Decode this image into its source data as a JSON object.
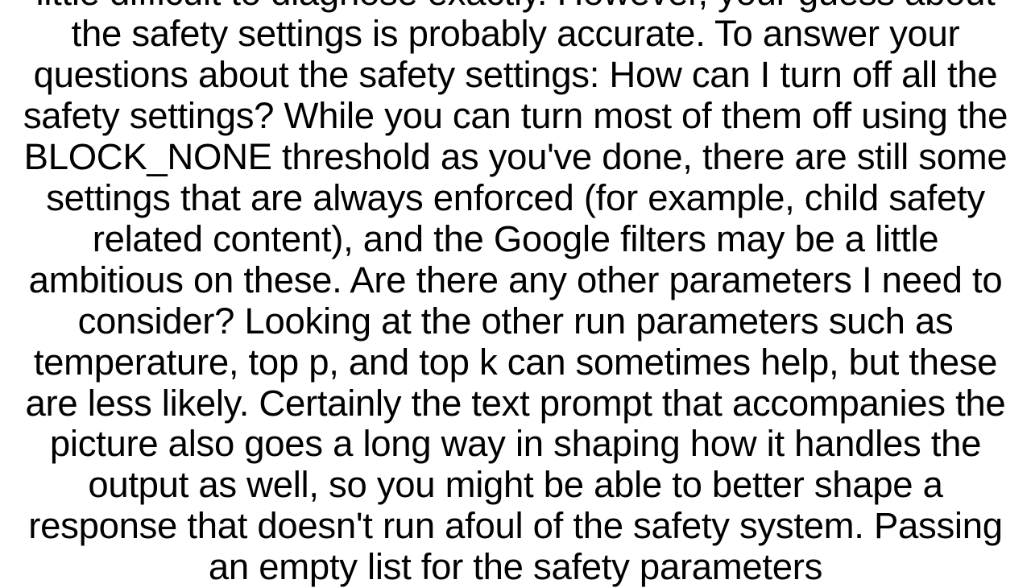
{
  "document": {
    "body": "little difficult to diagnose exactly. However, your guess about the safety settings is probably accurate. To answer your questions about the safety settings: How can I turn off all the safety settings? While you can turn most of them off using the BLOCK_NONE threshold as you've done, there are still some settings that are always enforced (for example, child safety related content), and the Google filters may be a little ambitious on these. Are there any other parameters I need to consider? Looking at the other run parameters such as temperature, top p, and top k can sometimes help, but these are less likely. Certainly the text prompt that accompanies the picture also goes a long way in shaping how it handles the output as well, so you might be able to better shape a response that doesn't run afoul of the safety system. Passing an empty list for the safety parameters"
  }
}
